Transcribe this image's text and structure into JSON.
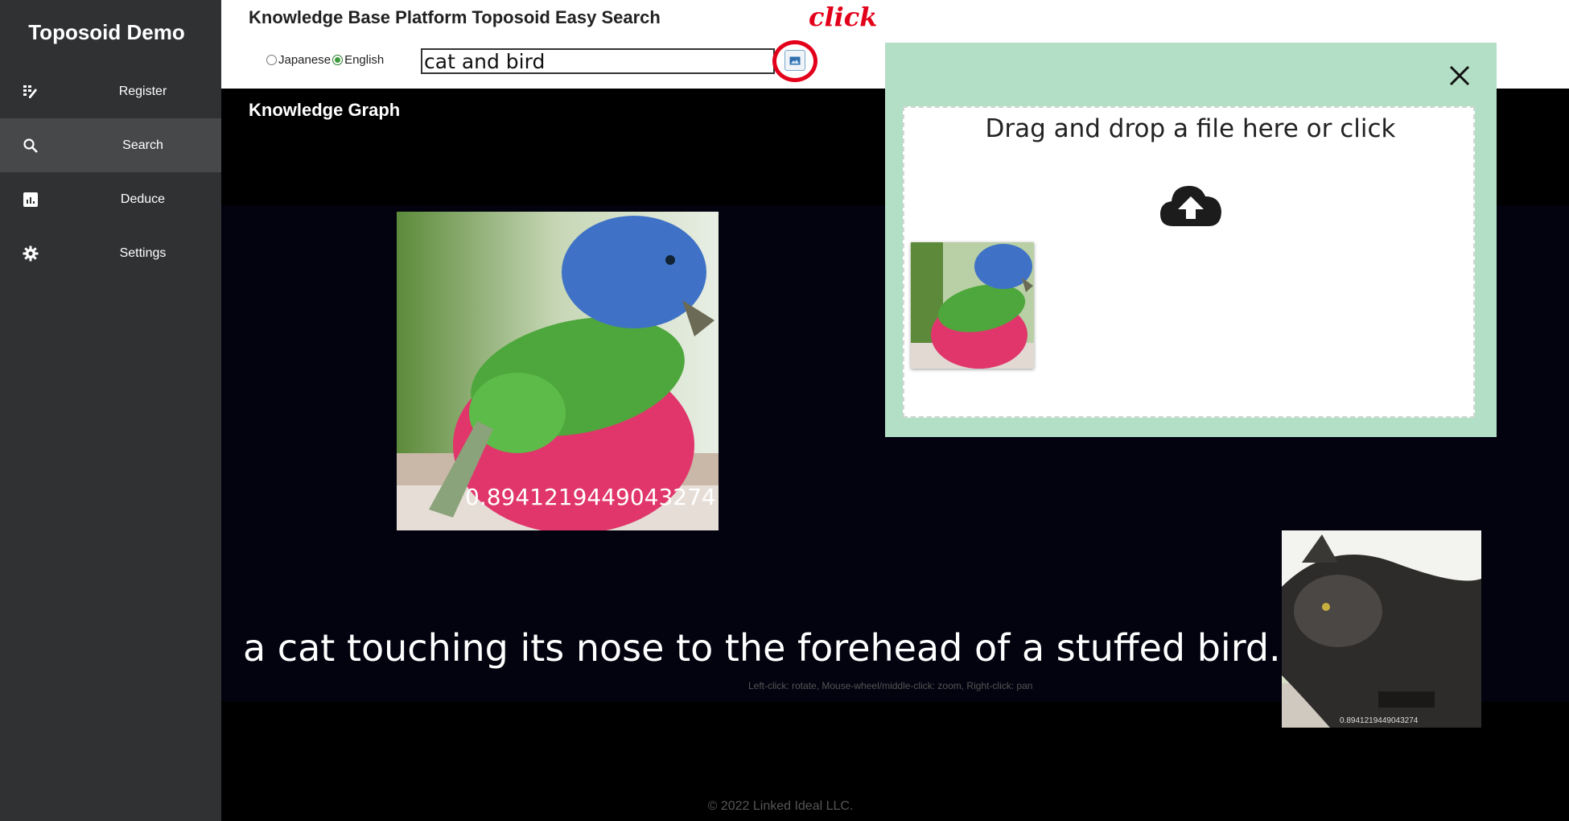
{
  "app": {
    "title": "Toposoid Demo"
  },
  "sidebar": {
    "items": [
      {
        "label": "Register",
        "icon": "grid-edit-icon"
      },
      {
        "label": "Search",
        "icon": "search-icon"
      },
      {
        "label": "Deduce",
        "icon": "bar-chart-icon"
      },
      {
        "label": "Settings",
        "icon": "gear-icon"
      }
    ],
    "active": "Search"
  },
  "header": {
    "title": "Knowledge Base Platform Toposoid Easy Search",
    "languages": [
      {
        "label": "Japanese",
        "checked": false
      },
      {
        "label": "English",
        "checked": true
      }
    ],
    "search_value": "cat and bird",
    "annotation": "click"
  },
  "graph": {
    "title": "Knowledge Graph",
    "bird_node_score": "0.8941219449043274",
    "cat_node_score": "0.8941219449043274",
    "caption": "a cat touching its nose to the forehead of a stuffed bird.",
    "hint": "Left-click: rotate, Mouse-wheel/middle-click: zoom, Right-click: pan"
  },
  "modal": {
    "dropzone_text": "Drag and drop a file here or click"
  },
  "footer": {
    "text": "© 2022 Linked Ideal LLC."
  },
  "colors": {
    "sidebar_bg": "#2f3133",
    "sidebar_active": "#46484a",
    "modal_bg": "#b2dfc5",
    "annotation_red": "#e3001b"
  }
}
